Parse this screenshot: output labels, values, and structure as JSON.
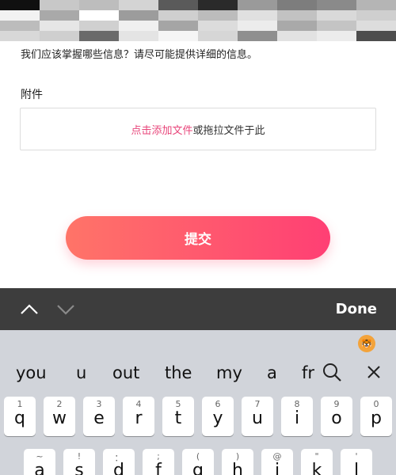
{
  "form": {
    "hint_text": "我们应该掌握哪些信息？请尽可能提供详细的信息。",
    "attachment_label": "附件",
    "upload_link_text": "点击添加文件",
    "upload_rest_text": "或拖拉文件于此",
    "submit_label": "提交"
  },
  "keyboard_toolbar": {
    "done_label": "Done",
    "prev_icon": "chevron-up-icon",
    "next_icon": "chevron-down-icon"
  },
  "keyboard": {
    "suggestions": [
      "you",
      "u",
      "out",
      "the",
      "my",
      "a",
      "fr"
    ],
    "row1": [
      {
        "num": "1",
        "letter": "q"
      },
      {
        "num": "2",
        "letter": "w"
      },
      {
        "num": "3",
        "letter": "e"
      },
      {
        "num": "4",
        "letter": "r"
      },
      {
        "num": "5",
        "letter": "t"
      },
      {
        "num": "6",
        "letter": "y"
      },
      {
        "num": "7",
        "letter": "u"
      },
      {
        "num": "8",
        "letter": "i"
      },
      {
        "num": "9",
        "letter": "o"
      },
      {
        "num": "0",
        "letter": "p"
      }
    ],
    "row2": [
      {
        "num": "~",
        "letter": "a"
      },
      {
        "num": "!",
        "letter": "s"
      },
      {
        "num": "：",
        "letter": "d"
      },
      {
        "num": ";",
        "letter": "f"
      },
      {
        "num": "(",
        "letter": "g"
      },
      {
        "num": ")",
        "letter": "h"
      },
      {
        "num": "@",
        "letter": "j"
      },
      {
        "num": "\"",
        "letter": "k"
      },
      {
        "num": "'",
        "letter": "l"
      }
    ]
  }
}
